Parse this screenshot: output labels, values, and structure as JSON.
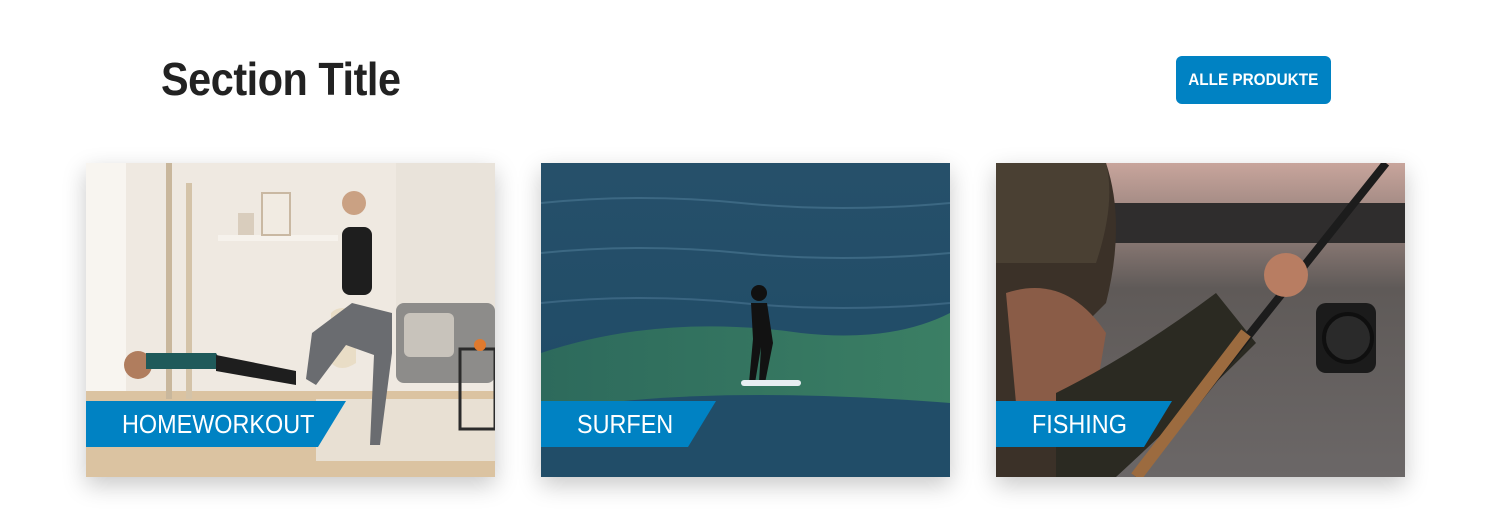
{
  "header": {
    "title": "Section Title",
    "all_products_label": "ALLE PRODUKTE"
  },
  "cards": [
    {
      "label": "HOMEWORKOUT",
      "image": "home-workout-photo"
    },
    {
      "label": "SURFEN",
      "image": "surfing-photo"
    },
    {
      "label": "FISHING",
      "image": "fishing-photo"
    }
  ],
  "colors": {
    "accent": "#0082c3",
    "title": "#222222",
    "background": "#ffffff"
  }
}
